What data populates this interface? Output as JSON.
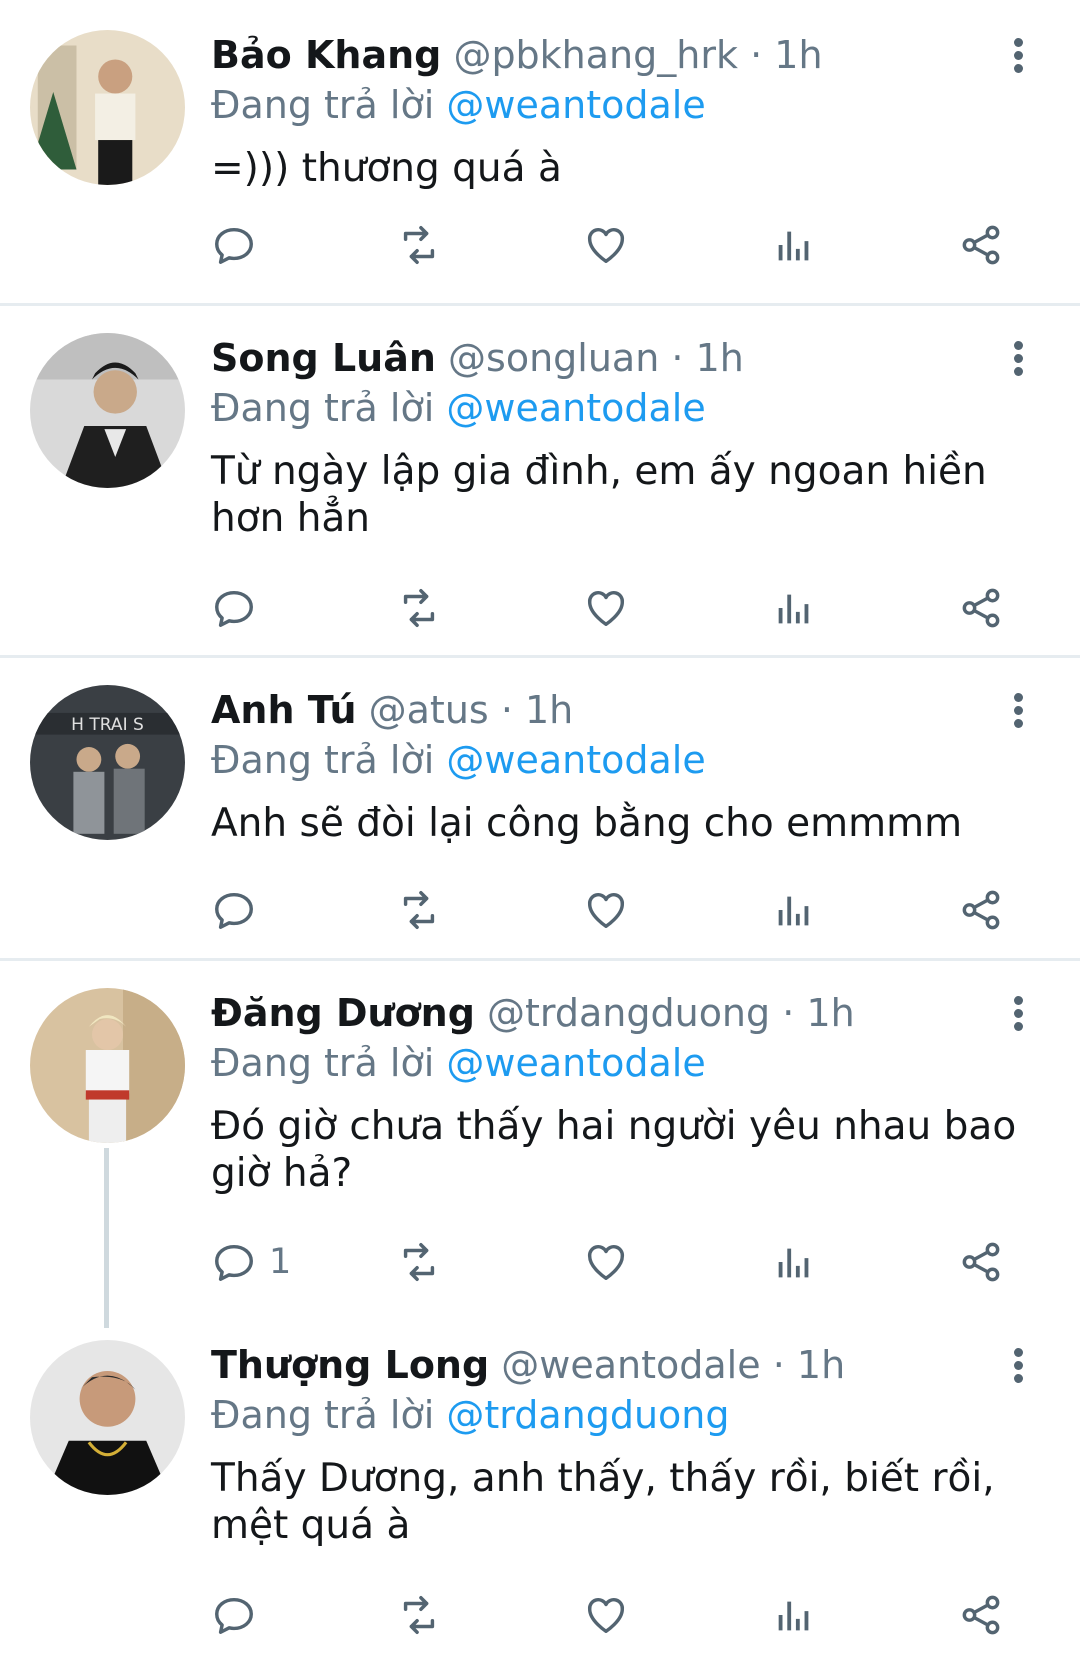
{
  "tweets": [
    {
      "name": "Bảo Khang",
      "handle": "@pbkhang_hrk",
      "dot": "·",
      "time": "1h",
      "reply_prefix": "Đang trả lời",
      "reply_to": "@weantodale",
      "text": "=))) thương quá à",
      "reply_count": "",
      "avatar_colors": [
        "#e8ddc8",
        "#2f5d3a",
        "#f3efe4"
      ]
    },
    {
      "name": "Song Luân",
      "handle": "@songluan",
      "dot": "·",
      "time": "1h",
      "reply_prefix": "Đang trả lời",
      "reply_to": "@weantodale",
      "text": "Từ ngày lập gia đình, em ấy ngoan hiền hơn hẳn",
      "reply_count": "",
      "avatar_colors": [
        "#d9d9d9",
        "#1f1f1f",
        "#c9a98a"
      ]
    },
    {
      "name": "Anh Tú",
      "handle": "@atus",
      "dot": "·",
      "time": "1h",
      "reply_prefix": "Đang trả lời",
      "reply_to": "@weantodale",
      "text": "Anh sẽ đòi lại công bằng cho emmmm",
      "reply_count": "",
      "avatar_colors": [
        "#3a3f44",
        "#8f9499",
        "#e0e0e0"
      ]
    },
    {
      "name": "Đăng Dương",
      "handle": "@trdangduong",
      "dot": "·",
      "time": "1h",
      "reply_prefix": "Đang trả lời",
      "reply_to": "@weantodale",
      "text": "Đó giờ chưa thấy hai người yêu nhau bao giờ hả?",
      "reply_count": "1",
      "avatar_colors": [
        "#d8c2a0",
        "#f5f5f5",
        "#c0392b"
      ]
    },
    {
      "name": "Thượng Long",
      "handle": "@weantodale",
      "dot": "·",
      "time": "1h",
      "reply_prefix": "Đang trả lời",
      "reply_to": "@trdangduong",
      "text": "Thấy Dương, anh thấy, thấy rồi, biết rồi, mệt quá à",
      "reply_count": "",
      "avatar_colors": [
        "#e6e6e6",
        "#111111",
        "#c79a7a"
      ]
    }
  ],
  "icons": {
    "reply": "reply-icon",
    "retweet": "retweet-icon",
    "like": "heart-icon",
    "views": "analytics-icon",
    "share": "share-icon",
    "more": "more-vertical-icon"
  },
  "colors": {
    "link": "#1d9bf0",
    "muted": "#657786",
    "icon": "#536471",
    "divider": "#e6ecf0"
  }
}
